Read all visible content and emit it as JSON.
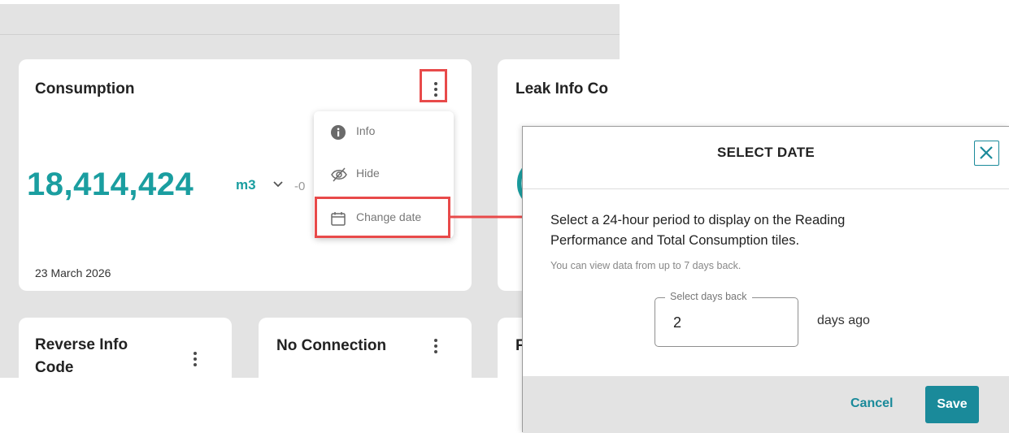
{
  "dashboard": {
    "consumption_tile": {
      "title": "Consumption",
      "value": "18,414,424",
      "unit": "m3",
      "trend": "-0",
      "date": "23 March 2026"
    },
    "leak_tile": {
      "title": "Leak Info Co",
      "value_partial": "("
    },
    "reverse_tile": {
      "title": "Reverse Info Code"
    },
    "no_connection_tile": {
      "title": "No Connection"
    },
    "partial_tile": {
      "title": "F"
    }
  },
  "context_menu": {
    "items": [
      {
        "label": "Info",
        "icon": "info-icon"
      },
      {
        "label": "Hide",
        "icon": "eye-off-icon"
      },
      {
        "label": "Change date",
        "icon": "calendar-icon"
      }
    ]
  },
  "dialog": {
    "title": "SELECT DATE",
    "description": "Select a 24-hour period to display on the Reading Performance and Total Consumption tiles.",
    "hint": "You can view data from up to 7 days back.",
    "field_label": "Select days back",
    "field_value": "2",
    "suffix": "days ago",
    "cancel_label": "Cancel",
    "save_label": "Save"
  },
  "colors": {
    "accent": "#1a9ea0",
    "button": "#1a8a9a",
    "highlight": "#e84a4a",
    "background": "#e3e3e3"
  }
}
